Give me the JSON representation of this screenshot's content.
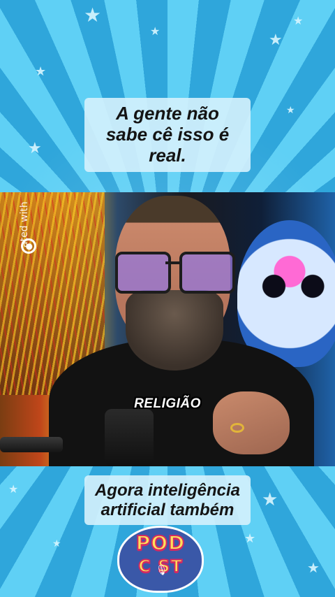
{
  "captions": {
    "top": "A gente não sabe cê isso é real.",
    "bottom": "Agora inteligência artificial também"
  },
  "video": {
    "subtitle": "RELIGIÃO",
    "watermark_text": "ated with"
  },
  "logo": {
    "line1": "POD",
    "line2": "C  ST",
    "mic_icon": "microphone-icon"
  },
  "colors": {
    "background": "#39b7e6",
    "caption_bg": "#d2f0fc",
    "logo_badge": "#3a58a8",
    "logo_text": "#ffe05a",
    "logo_outline": "#d12a63"
  }
}
